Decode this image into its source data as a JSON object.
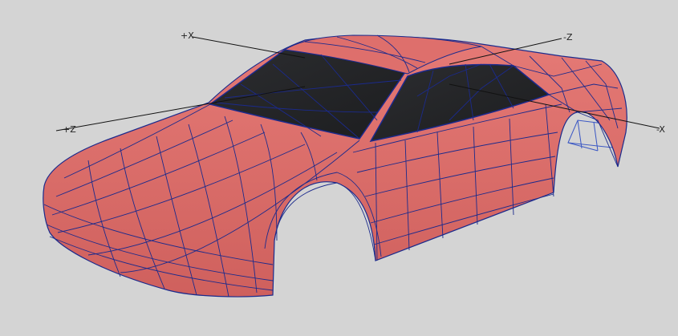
{
  "viewport": {
    "background": "#d4d4d4",
    "model": {
      "body_color": "#e0706d",
      "body_shadow": "#c25a58",
      "glass_color": "#232426",
      "wire_color": "#1b2a8c",
      "interior_color": "#3a57c4"
    },
    "axis_color": "#111111",
    "axis_labels": {
      "pos_x": "+X",
      "neg_z": "-Z",
      "pos_z": "+Z",
      "neg_x": "-X"
    }
  }
}
